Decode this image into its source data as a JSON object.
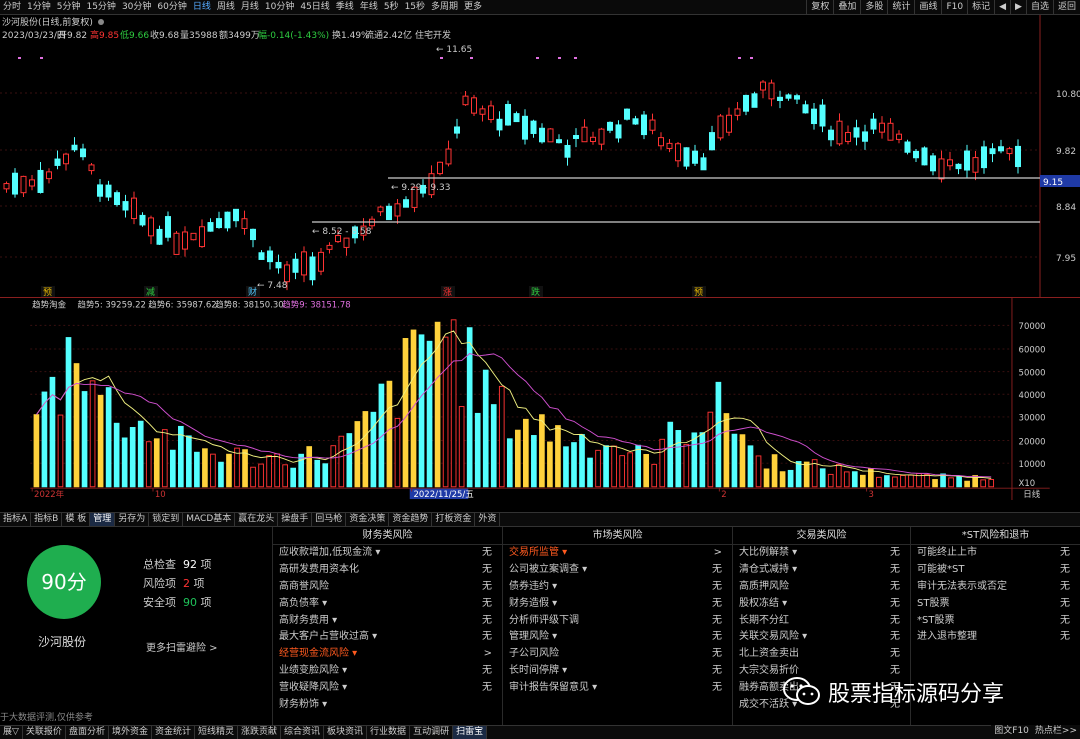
{
  "period_tabs": [
    "分时",
    "1分钟",
    "5分钟",
    "15分钟",
    "30分钟",
    "60分钟",
    "日线",
    "周线",
    "月线",
    "10分钟",
    "45日线",
    "季线",
    "年线",
    "5秒",
    "15秒",
    "多周期",
    "更多"
  ],
  "active_period": "日线",
  "right_tools": [
    "复权",
    "叠加",
    "多股",
    "统计",
    "画线",
    "F10",
    "标记",
    "◀",
    "▶",
    "自选",
    "返回"
  ],
  "stock_header": "沙河股份(日线,前复权)",
  "info_line": {
    "date": "2023/03/23/四",
    "open": "开9.82",
    "high": "高9.85",
    "low": "低9.66",
    "close": "收9.68",
    "vol": "量35988",
    "amt": "额3499万",
    "chg": "幅-0.14(-1.43%)",
    "turn": "换1.49%",
    "flow": "流通2.42亿",
    "sector": "住宅开发"
  },
  "price_axis": [
    "10.80",
    "9.82",
    "8.84",
    "7.95"
  ],
  "price_tag": "9.15",
  "annotations": {
    "high": "11.65",
    "low": "7.48",
    "range1": "9.29 - 9.33",
    "range2": "8.52 - 8.58"
  },
  "markers": [
    "预",
    "减",
    "财",
    "涨",
    "跌",
    "预"
  ],
  "indicator_line": {
    "name": "趋势淘金",
    "t5": "趋势5: 39259.22",
    "t6": "趋势6: 35987.62",
    "t8": "趋势8: 38150.30",
    "t9": "趋势9: 38151.78"
  },
  "vol_axis": [
    "70000",
    "60000",
    "50000",
    "40000",
    "30000",
    "20000",
    "10000",
    "X10"
  ],
  "date_axis": [
    "2022年",
    "10",
    "2022/11/25/五",
    "2",
    "3",
    "日线"
  ],
  "bottom_tabs": [
    "指标A",
    "指标B",
    "模 板",
    "管理",
    "另存为",
    "锁定到",
    "MACD基本",
    "赢在龙头",
    "操盘手",
    "回马枪",
    "资金决策",
    "资金趋势",
    "打板资金",
    "外资"
  ],
  "active_bottom_tab": "管理",
  "score": {
    "value": "90分",
    "stock": "沙河股份",
    "total_label": "总检查",
    "total_val": "92",
    "total_unit": "项",
    "risk_label": "风险项",
    "risk_val": "2",
    "risk_unit": "项",
    "safe_label": "安全项",
    "safe_val": "90",
    "safe_unit": "项",
    "more": "更多扫雷避险 >",
    "note": "于大数据评测,仅供参考"
  },
  "columns": [
    {
      "title": "财务类风险",
      "rows": [
        [
          "应收款增加,低现金流 ▾",
          "无",
          false
        ],
        [
          "高研发费用资本化",
          "无",
          false
        ],
        [
          "高商誉风险",
          "无",
          false
        ],
        [
          "高负债率 ▾",
          "无",
          false
        ],
        [
          "高财务费用 ▾",
          "无",
          false
        ],
        [
          "最大客户占营收过高 ▾",
          "无",
          false
        ],
        [
          "经营现金流风险 ▾",
          ">",
          true
        ],
        [
          "业绩变脸风险 ▾",
          "无",
          false
        ],
        [
          "营收疑降风险 ▾",
          "无",
          false
        ],
        [
          "财务粉饰 ▾",
          "",
          false
        ]
      ]
    },
    {
      "title": "市场类风险",
      "rows": [
        [
          "交易所监管 ▾",
          ">",
          true
        ],
        [
          "公司被立案调查 ▾",
          "无",
          false
        ],
        [
          "债券违约 ▾",
          "无",
          false
        ],
        [
          "财务造假 ▾",
          "无",
          false
        ],
        [
          "分析师评级下调",
          "无",
          false
        ],
        [
          "管理风险 ▾",
          "无",
          false
        ],
        [
          "子公司风险",
          "无",
          false
        ],
        [
          "长时间停牌 ▾",
          "无",
          false
        ],
        [
          "审计报告保留意见 ▾",
          "无",
          false
        ]
      ]
    },
    {
      "title": "交易类风险",
      "rows": [
        [
          "大比例解禁 ▾",
          "无",
          false
        ],
        [
          "清仓式减持 ▾",
          "无",
          false
        ],
        [
          "高质押风险",
          "无",
          false
        ],
        [
          "股权冻结 ▾",
          "无",
          false
        ],
        [
          "长期不分红",
          "无",
          false
        ],
        [
          "关联交易风险 ▾",
          "无",
          false
        ],
        [
          "北上资金卖出",
          "无",
          false
        ],
        [
          "大宗交易折价",
          "无",
          false
        ],
        [
          "融券高额卖出",
          "无",
          false
        ],
        [
          "成交不活跃 ▾",
          "无",
          false
        ]
      ]
    },
    {
      "title": "*ST风险和退市",
      "rows": [
        [
          "可能终止上市",
          "无",
          false
        ],
        [
          "可能被*ST",
          "无",
          false
        ],
        [
          "审计无法表示或否定",
          "无",
          false
        ],
        [
          "ST股票",
          "无",
          false
        ],
        [
          "*ST股票",
          "无",
          false
        ],
        [
          "进入退市整理",
          "无",
          false
        ]
      ]
    }
  ],
  "status_tabs": [
    "展▽",
    "关联报价",
    "盘面分析",
    "境外资金",
    "资金统计",
    "短线精灵",
    "涨跌贡献",
    "综合资讯",
    "板块资讯",
    "行业数据",
    "互动调研",
    "扫雷宝"
  ],
  "active_status": "扫雷宝",
  "status_right": [
    "图文F10",
    "热点栏>>"
  ],
  "watermark": "股票指标源码分享"
}
